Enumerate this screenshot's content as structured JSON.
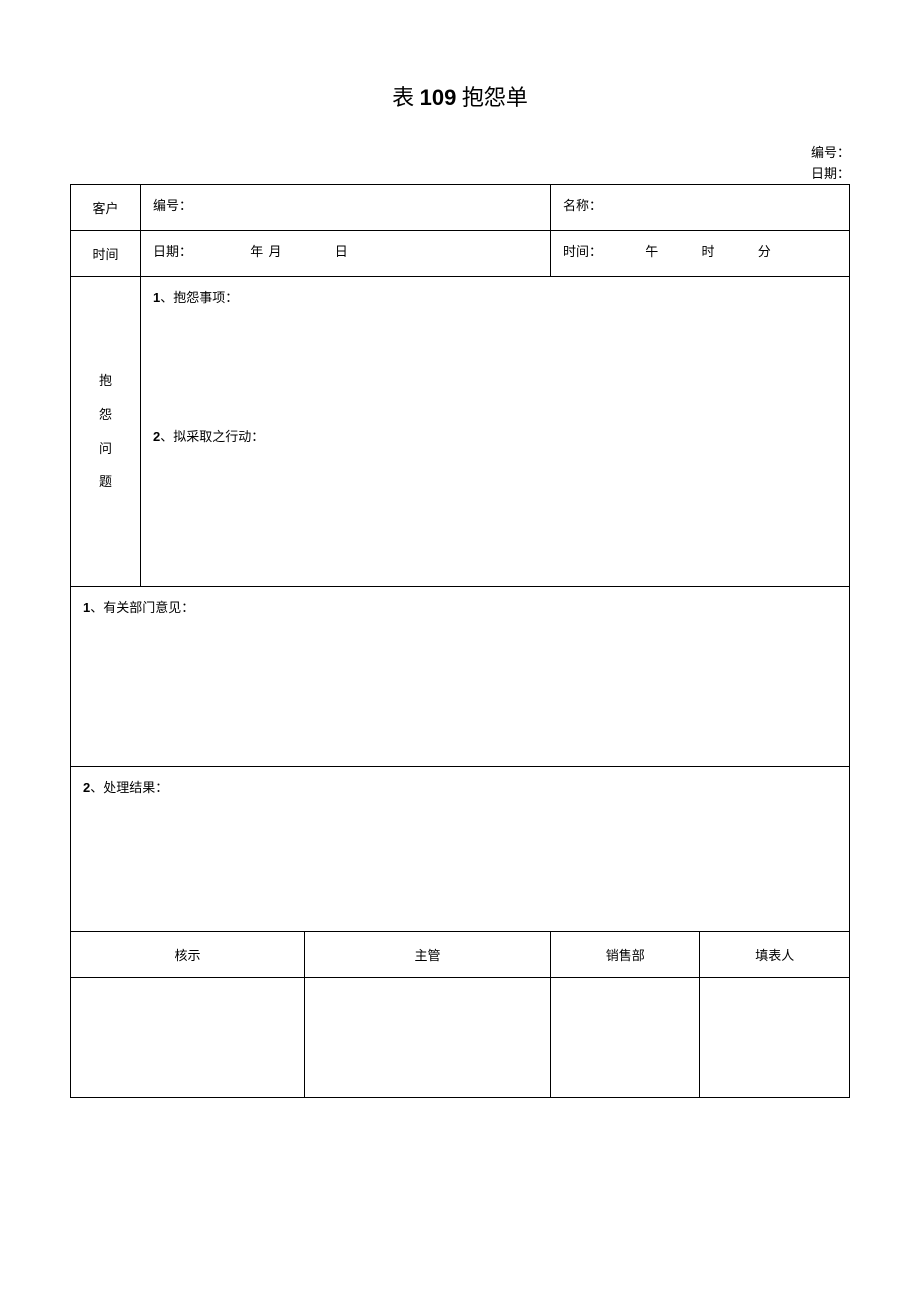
{
  "title_prefix": "表 ",
  "title_num": "109",
  "title_suffix": " 抱怨单",
  "header": {
    "serial_label": "编号：",
    "date_label": "日期："
  },
  "row_customer": {
    "label": "客户",
    "serial": "编号：",
    "name": "名称："
  },
  "row_time": {
    "label": "时间",
    "date_label": "日期：",
    "year": "年",
    "month": "月",
    "day": "日",
    "time_label": "时间：",
    "ampm": "午",
    "hour": "时",
    "minute": "分"
  },
  "complaint": {
    "label_chars": [
      "抱",
      "怨",
      "问",
      "题"
    ],
    "item1_num": "1",
    "item1_text": "、抱怨事项：",
    "item2_num": "2",
    "item2_text": "、拟采取之行动："
  },
  "opinion": {
    "num": "1",
    "text": "、有关部门意见："
  },
  "result": {
    "num": "2",
    "text": "、处理结果："
  },
  "sig": {
    "c1": "核示",
    "c2": "主管",
    "c3": "销售部",
    "c4": "填表人"
  }
}
